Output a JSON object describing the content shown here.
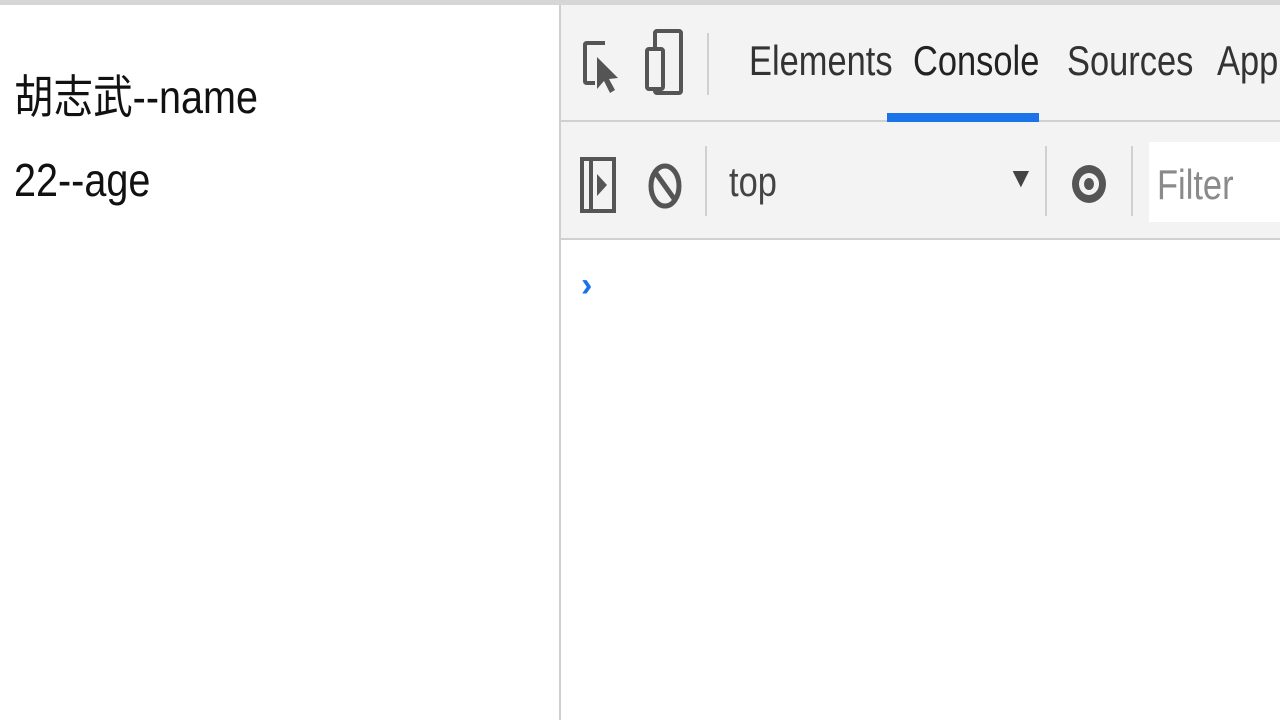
{
  "page": {
    "lines": [
      "胡志武--name",
      "22--age"
    ]
  },
  "devtools": {
    "tabs": [
      {
        "label": "Elements",
        "active": false
      },
      {
        "label": "Console",
        "active": true
      },
      {
        "label": "Sources",
        "active": false
      },
      {
        "label": "Appli",
        "active": false
      }
    ],
    "toolbar": {
      "context": "top",
      "filter_placeholder": "Filter"
    },
    "console": {
      "prompt_symbol": "›"
    },
    "icons": {
      "inspect": "inspect-element-icon",
      "device": "device-toolbar-icon",
      "sidebar": "show-sidebar-icon",
      "clear": "clear-console-icon",
      "dropdown": "dropdown-arrow-icon",
      "eye": "live-expression-icon"
    },
    "colors": {
      "accent": "#1a73e8",
      "toolbar_bg": "#f3f3f3",
      "border": "#d0d0d0"
    }
  }
}
